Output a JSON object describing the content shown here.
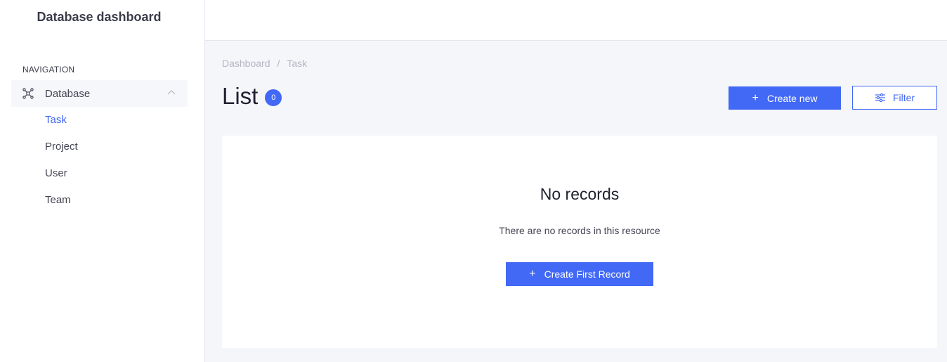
{
  "app": {
    "title": "Database dashboard"
  },
  "sidebar": {
    "heading": "NAVIGATION",
    "group": {
      "label": "Database",
      "icon": "network-icon",
      "expanded": true
    },
    "items": [
      {
        "label": "Task",
        "active": true
      },
      {
        "label": "Project",
        "active": false
      },
      {
        "label": "User",
        "active": false
      },
      {
        "label": "Team",
        "active": false
      }
    ]
  },
  "breadcrumb": {
    "root": "Dashboard",
    "separator": "/",
    "current": "Task"
  },
  "page": {
    "title": "List",
    "count": "0"
  },
  "actions": {
    "create_label": "Create new",
    "filter_label": "Filter",
    "plus": "+"
  },
  "empty": {
    "title": "No records",
    "text": "There are no records in this resource",
    "button_label": "Create First Record"
  },
  "colors": {
    "accent": "#4268f6",
    "background": "#f5f6fa",
    "text": "#454655"
  }
}
